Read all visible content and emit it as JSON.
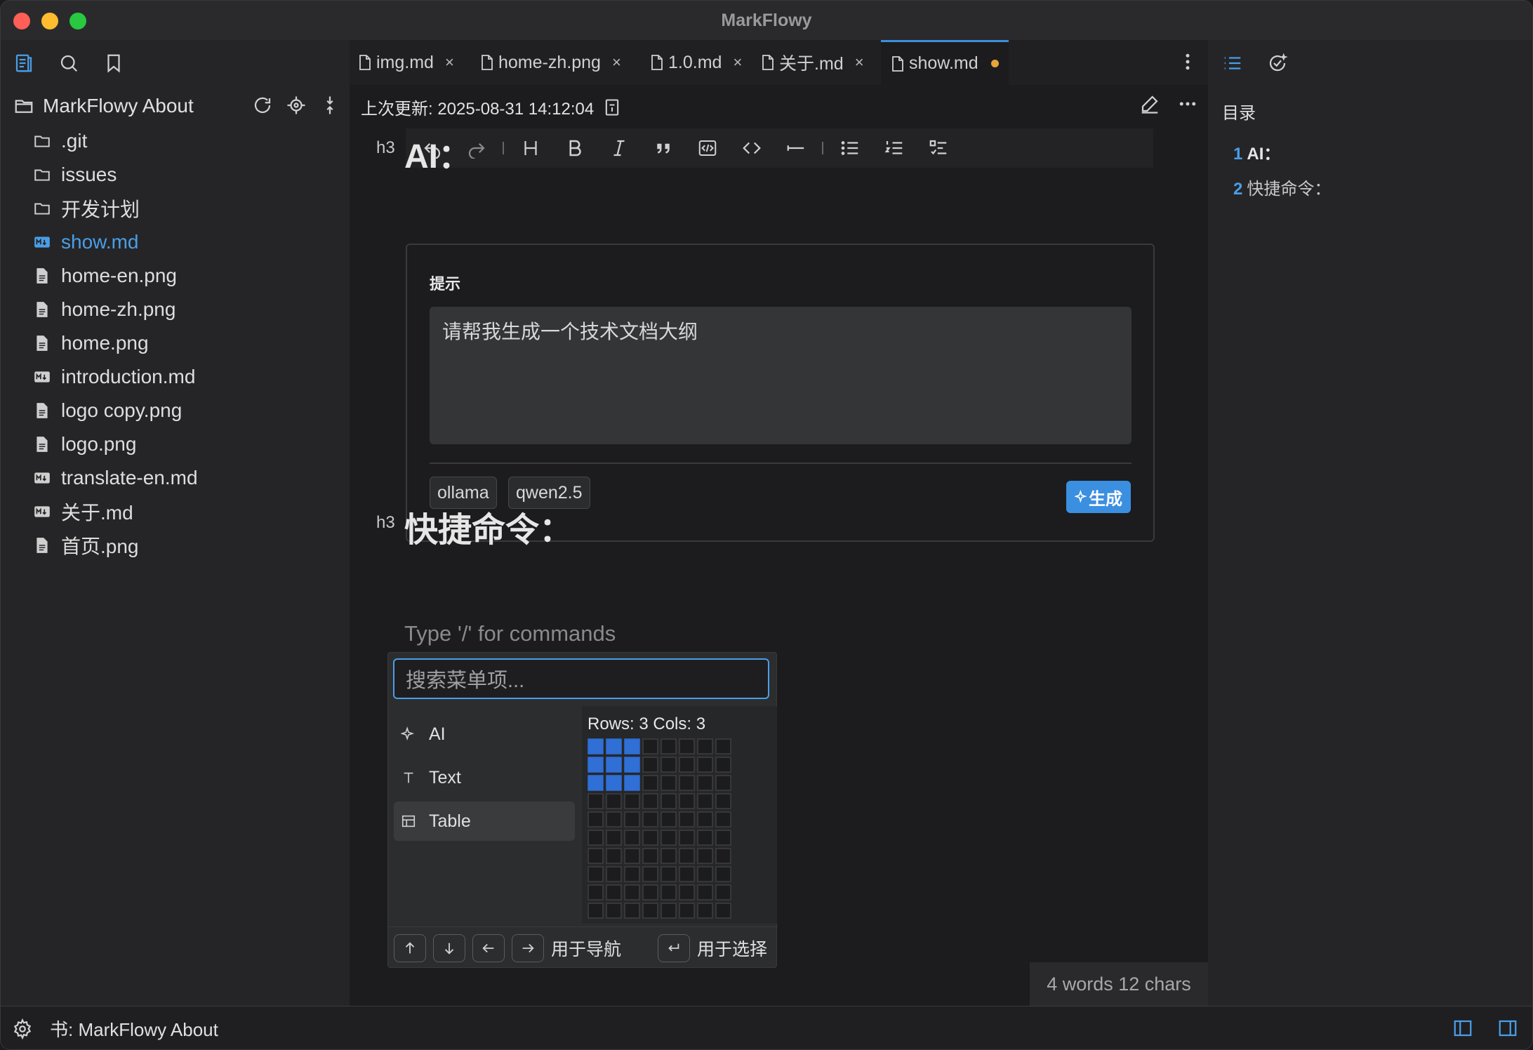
{
  "window": {
    "title": "MarkFlowy"
  },
  "sidebar": {
    "root_label": "MarkFlowy About",
    "items": [
      {
        "label": ".git",
        "type": "folder",
        "active": false
      },
      {
        "label": "issues",
        "type": "folder",
        "active": false
      },
      {
        "label": "开发计划",
        "type": "folder",
        "active": false
      },
      {
        "label": "show.md",
        "type": "md",
        "active": true
      },
      {
        "label": "home-en.png",
        "type": "file",
        "active": false
      },
      {
        "label": "home-zh.png",
        "type": "file",
        "active": false
      },
      {
        "label": "home.png",
        "type": "file",
        "active": false
      },
      {
        "label": "introduction.md",
        "type": "md",
        "active": false
      },
      {
        "label": "logo copy.png",
        "type": "file",
        "active": false
      },
      {
        "label": "logo.png",
        "type": "file",
        "active": false
      },
      {
        "label": "translate-en.md",
        "type": "md",
        "active": false
      },
      {
        "label": "关于.md",
        "type": "md",
        "active": false
      },
      {
        "label": "首页.png",
        "type": "file",
        "active": false
      }
    ]
  },
  "tabs": [
    {
      "label": "img.md",
      "close": "×"
    },
    {
      "label": "home-zh.png",
      "close": "×"
    },
    {
      "label": "1.0.md",
      "close": "×"
    },
    {
      "label": "关于.md",
      "close": "×"
    },
    {
      "label": "show.md",
      "modified": true
    }
  ],
  "editor": {
    "last_updated": "上次更新: 2025-08-31 14:12:04",
    "heading_level": "h3",
    "heading_ai": "AI：",
    "heading_shortcuts": "快捷命令：",
    "placeholder": "Type '/' for commands",
    "word_count": "4 words 12 chars"
  },
  "ai_block": {
    "hint_label": "提示",
    "prompt": "请帮我生成一个技术文档大纲",
    "provider": "ollama",
    "model": "qwen2.5",
    "generate_label": "生成"
  },
  "slash_menu": {
    "search_placeholder": "搜索菜单项...",
    "items": [
      {
        "label": "AI",
        "icon": "sparkle-icon"
      },
      {
        "label": "Text",
        "icon": "text-icon"
      },
      {
        "label": "Table",
        "icon": "table-icon"
      }
    ],
    "grid_label": "Rows: 3 Cols: 3",
    "grid_rows_selected": 3,
    "grid_cols_selected": 3,
    "footer_nav": "用于导航",
    "footer_select": "用于选择"
  },
  "toc": {
    "title": "目录",
    "items": [
      {
        "num": "1",
        "label": "AI："
      },
      {
        "num": "2",
        "label": "快捷命令："
      }
    ]
  },
  "statusbar": {
    "book": "书: MarkFlowy About"
  },
  "colors": {
    "accent": "#3b8fe0",
    "modified_dot": "#e8a53a",
    "grid_selected": "#2f6fd6"
  }
}
